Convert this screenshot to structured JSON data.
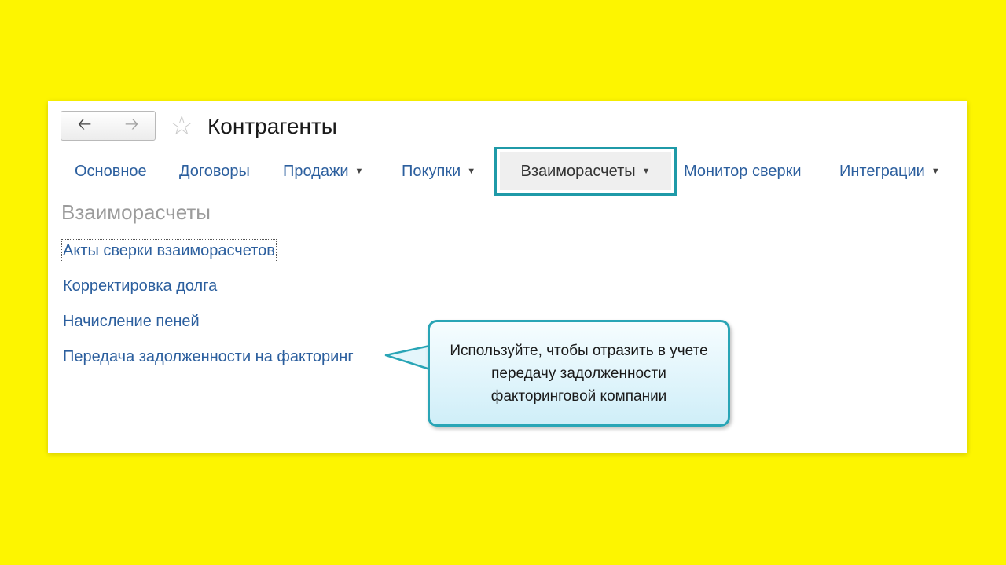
{
  "window": {
    "back_icon": "arrow-left-icon",
    "forward_icon": "arrow-right-icon",
    "favorite_icon": "star-icon",
    "title": "Контрагенты"
  },
  "tabs": [
    {
      "label": "Основное",
      "has_dropdown": false
    },
    {
      "label": "Договоры",
      "has_dropdown": false
    },
    {
      "label": "Продажи",
      "has_dropdown": true
    },
    {
      "label": "Покупки",
      "has_dropdown": true
    },
    {
      "label": "Взаиморасчеты",
      "has_dropdown": true,
      "active": true
    },
    {
      "label": "Монитор сверки",
      "has_dropdown": false
    },
    {
      "label": "Интеграции",
      "has_dropdown": true
    }
  ],
  "section": {
    "title": "Взаиморасчеты",
    "commands": [
      "Акты сверки взаиморасчетов",
      "Корректировка долга",
      "Начисление пеней",
      "Передача задолженности на факторинг"
    ]
  },
  "callout": {
    "text": "Используйте, чтобы отразить в учете передачу задолженности факторинговой компании"
  },
  "colors": {
    "background": "#fdf500",
    "link": "#2c5f9e",
    "highlight": "#1f9aa8"
  }
}
